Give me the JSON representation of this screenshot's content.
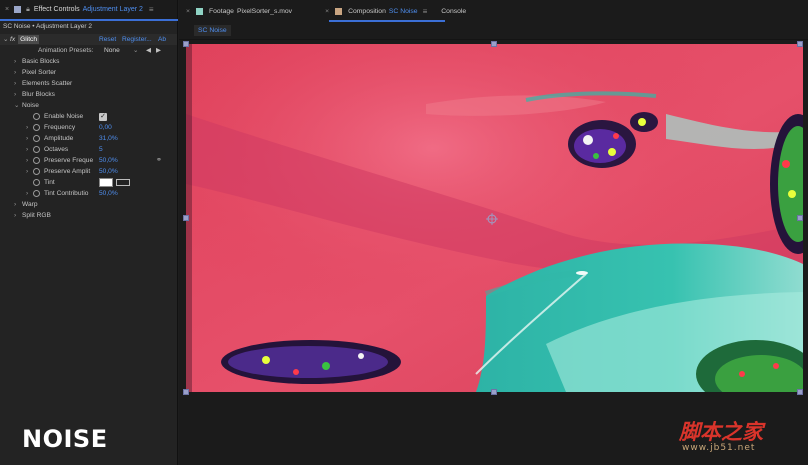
{
  "effect_controls": {
    "tab_close": "×",
    "tab_title": "Effect Controls",
    "tab_layer": "Adjustment Layer 2",
    "tab_menu": "≡",
    "breadcrumb": "SC Noise • Adjustment Layer 2",
    "effect": {
      "name": "Glitch",
      "reset": "Reset",
      "register": "Register...",
      "about": "Ab"
    },
    "presets": {
      "label": "Animation Presets:",
      "value": "None"
    },
    "groups": [
      "Basic Blocks",
      "Pixel Sorter",
      "Elements Scatter",
      "Blur Blocks"
    ],
    "noise_group": "Noise",
    "noise_props": {
      "enable_noise": {
        "label": "Enable Noise",
        "checked": true
      },
      "frequency": {
        "label": "Frequency",
        "value": "0,00"
      },
      "amplitude": {
        "label": "Amplitude",
        "value": "31,0%"
      },
      "octaves": {
        "label": "Octaves",
        "value": "5"
      },
      "preserve_freq": {
        "label": "Preserve Freque",
        "value": "50,0%"
      },
      "preserve_ampl": {
        "label": "Preserve Amplit",
        "value": "50,0%"
      },
      "tint": {
        "label": "Tint",
        "color": "#ffffff"
      },
      "tint_contrib": {
        "label": "Tint Contributio",
        "value": "50,0%"
      }
    },
    "after_groups": [
      "Warp",
      "Split RGB"
    ],
    "watermark": "NOISE"
  },
  "viewer_tabs": [
    {
      "close": "×",
      "label": "Footage",
      "highlight": "PixelSorter_s.mov",
      "color": "#8fd3c4"
    },
    {
      "close": "×",
      "label": "Composition",
      "highlight": "SC Noise",
      "color": "#c9a582",
      "menu": "≡"
    },
    {
      "label": "Console"
    }
  ],
  "subtab": "SC Noise",
  "site_logo": {
    "text": "脚本之家",
    "url": "www.jb51.net"
  },
  "accent_color": "#4f8ff0"
}
